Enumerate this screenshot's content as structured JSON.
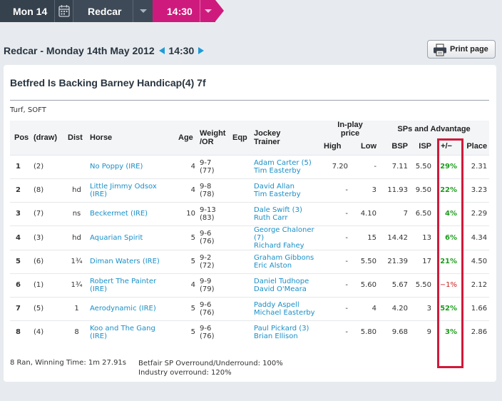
{
  "breadcrumb": {
    "date": "Mon 14",
    "course": "Redcar",
    "time": "14:30"
  },
  "header": {
    "title_prefix": "Redcar - Monday 14th May 2012",
    "time": "14:30",
    "print_label": "Print page"
  },
  "race": {
    "name": "Betfred Is Backing Barney Handicap(4) 7f",
    "going": "Turf, SOFT"
  },
  "columns": {
    "pos": "Pos",
    "draw": "(draw)",
    "dist": "Dist",
    "horse": "Horse",
    "age": "Age",
    "weight_line1": "Weight",
    "weight_line2": "/OR",
    "eqp": "Eqp",
    "jockey_line1": "Jockey",
    "jockey_line2": "Trainer",
    "inplay_line1": "In-play",
    "inplay_line2": "price",
    "high": "High",
    "low": "Low",
    "sp_group": "SPs and Advantage",
    "bsp": "BSP",
    "isp": "ISP",
    "adv": "+/−",
    "place": "Place"
  },
  "rows": [
    {
      "pos": "1",
      "draw": "(2)",
      "dist": "",
      "horse": "No Poppy (IRE)",
      "age": "4",
      "weight": "9-7",
      "or": "(77)",
      "eqp": "",
      "jockey": "Adam Carter (5)",
      "trainer": "Tim Easterby",
      "high": "7.20",
      "low": "-",
      "bsp": "7.11",
      "isp": "5.50",
      "adv": "29%",
      "adv_sign": "pos",
      "place": "2.31"
    },
    {
      "pos": "2",
      "draw": "(8)",
      "dist": "hd",
      "horse": "Little Jimmy Odsox (IRE)",
      "age": "4",
      "weight": "9-8",
      "or": "(78)",
      "eqp": "",
      "jockey": "David Allan",
      "trainer": "Tim Easterby",
      "high": "-",
      "low": "3",
      "bsp": "11.93",
      "isp": "9.50",
      "adv": "22%",
      "adv_sign": "pos",
      "place": "3.23"
    },
    {
      "pos": "3",
      "draw": "(7)",
      "dist": "ns",
      "horse": "Beckermet (IRE)",
      "age": "10",
      "weight": "9-13",
      "or": "(83)",
      "eqp": "",
      "jockey": "Dale Swift (3)",
      "trainer": "Ruth Carr",
      "high": "-",
      "low": "4.10",
      "bsp": "7",
      "isp": "6.50",
      "adv": "4%",
      "adv_sign": "pos",
      "place": "2.29"
    },
    {
      "pos": "4",
      "draw": "(3)",
      "dist": "hd",
      "horse": "Aquarian Spirit",
      "age": "5",
      "weight": "9-6",
      "or": "(76)",
      "eqp": "",
      "jockey": "George Chaloner (7)",
      "trainer": "Richard Fahey",
      "high": "-",
      "low": "15",
      "bsp": "14.42",
      "isp": "13",
      "adv": "6%",
      "adv_sign": "pos",
      "place": "4.34"
    },
    {
      "pos": "5",
      "draw": "(6)",
      "dist": "1¾",
      "horse": "Diman Waters (IRE)",
      "age": "5",
      "weight": "9-2",
      "or": "(72)",
      "eqp": "",
      "jockey": "Graham Gibbons",
      "trainer": "Eric Alston",
      "high": "-",
      "low": "5.50",
      "bsp": "21.39",
      "isp": "17",
      "adv": "21%",
      "adv_sign": "pos",
      "place": "4.50"
    },
    {
      "pos": "6",
      "draw": "(1)",
      "dist": "1¾",
      "horse": "Robert The Painter (IRE)",
      "age": "4",
      "weight": "9-9",
      "or": "(79)",
      "eqp": "",
      "jockey": "Daniel Tudhope",
      "trainer": "David O'Meara",
      "high": "-",
      "low": "5.60",
      "bsp": "5.67",
      "isp": "5.50",
      "adv": "−1%",
      "adv_sign": "neg",
      "place": "2.12"
    },
    {
      "pos": "7",
      "draw": "(5)",
      "dist": "1",
      "horse": "Aerodynamic (IRE)",
      "age": "5",
      "weight": "9-6",
      "or": "(76)",
      "eqp": "",
      "jockey": "Paddy Aspell",
      "trainer": "Michael Easterby",
      "high": "-",
      "low": "4",
      "bsp": "4.20",
      "isp": "3",
      "adv": "52%",
      "adv_sign": "pos",
      "place": "1.66"
    },
    {
      "pos": "8",
      "draw": "(4)",
      "dist": "8",
      "horse": "Koo and The Gang (IRE)",
      "age": "5",
      "weight": "9-6",
      "or": "(76)",
      "eqp": "",
      "jockey": "Paul Pickard (3)",
      "trainer": "Brian Ellison",
      "high": "-",
      "low": "5.80",
      "bsp": "9.68",
      "isp": "9",
      "adv": "3%",
      "adv_sign": "pos",
      "place": "2.86"
    }
  ],
  "footer": {
    "ran": "8 Ran, Winning Time:  1m 27.91s",
    "betfair_overround": "Betfair SP Overround/Underround: 100%",
    "industry_overround": "Industry overround: 120%"
  },
  "colors": {
    "breadcrumb_dark": "#36414e",
    "breadcrumb_accent": "#cf1a7d",
    "link": "#1a8fc7",
    "advantage_positive": "#1e9b1e",
    "advantage_negative": "#cc1f1f",
    "highlight_box": "#d01a3a"
  }
}
